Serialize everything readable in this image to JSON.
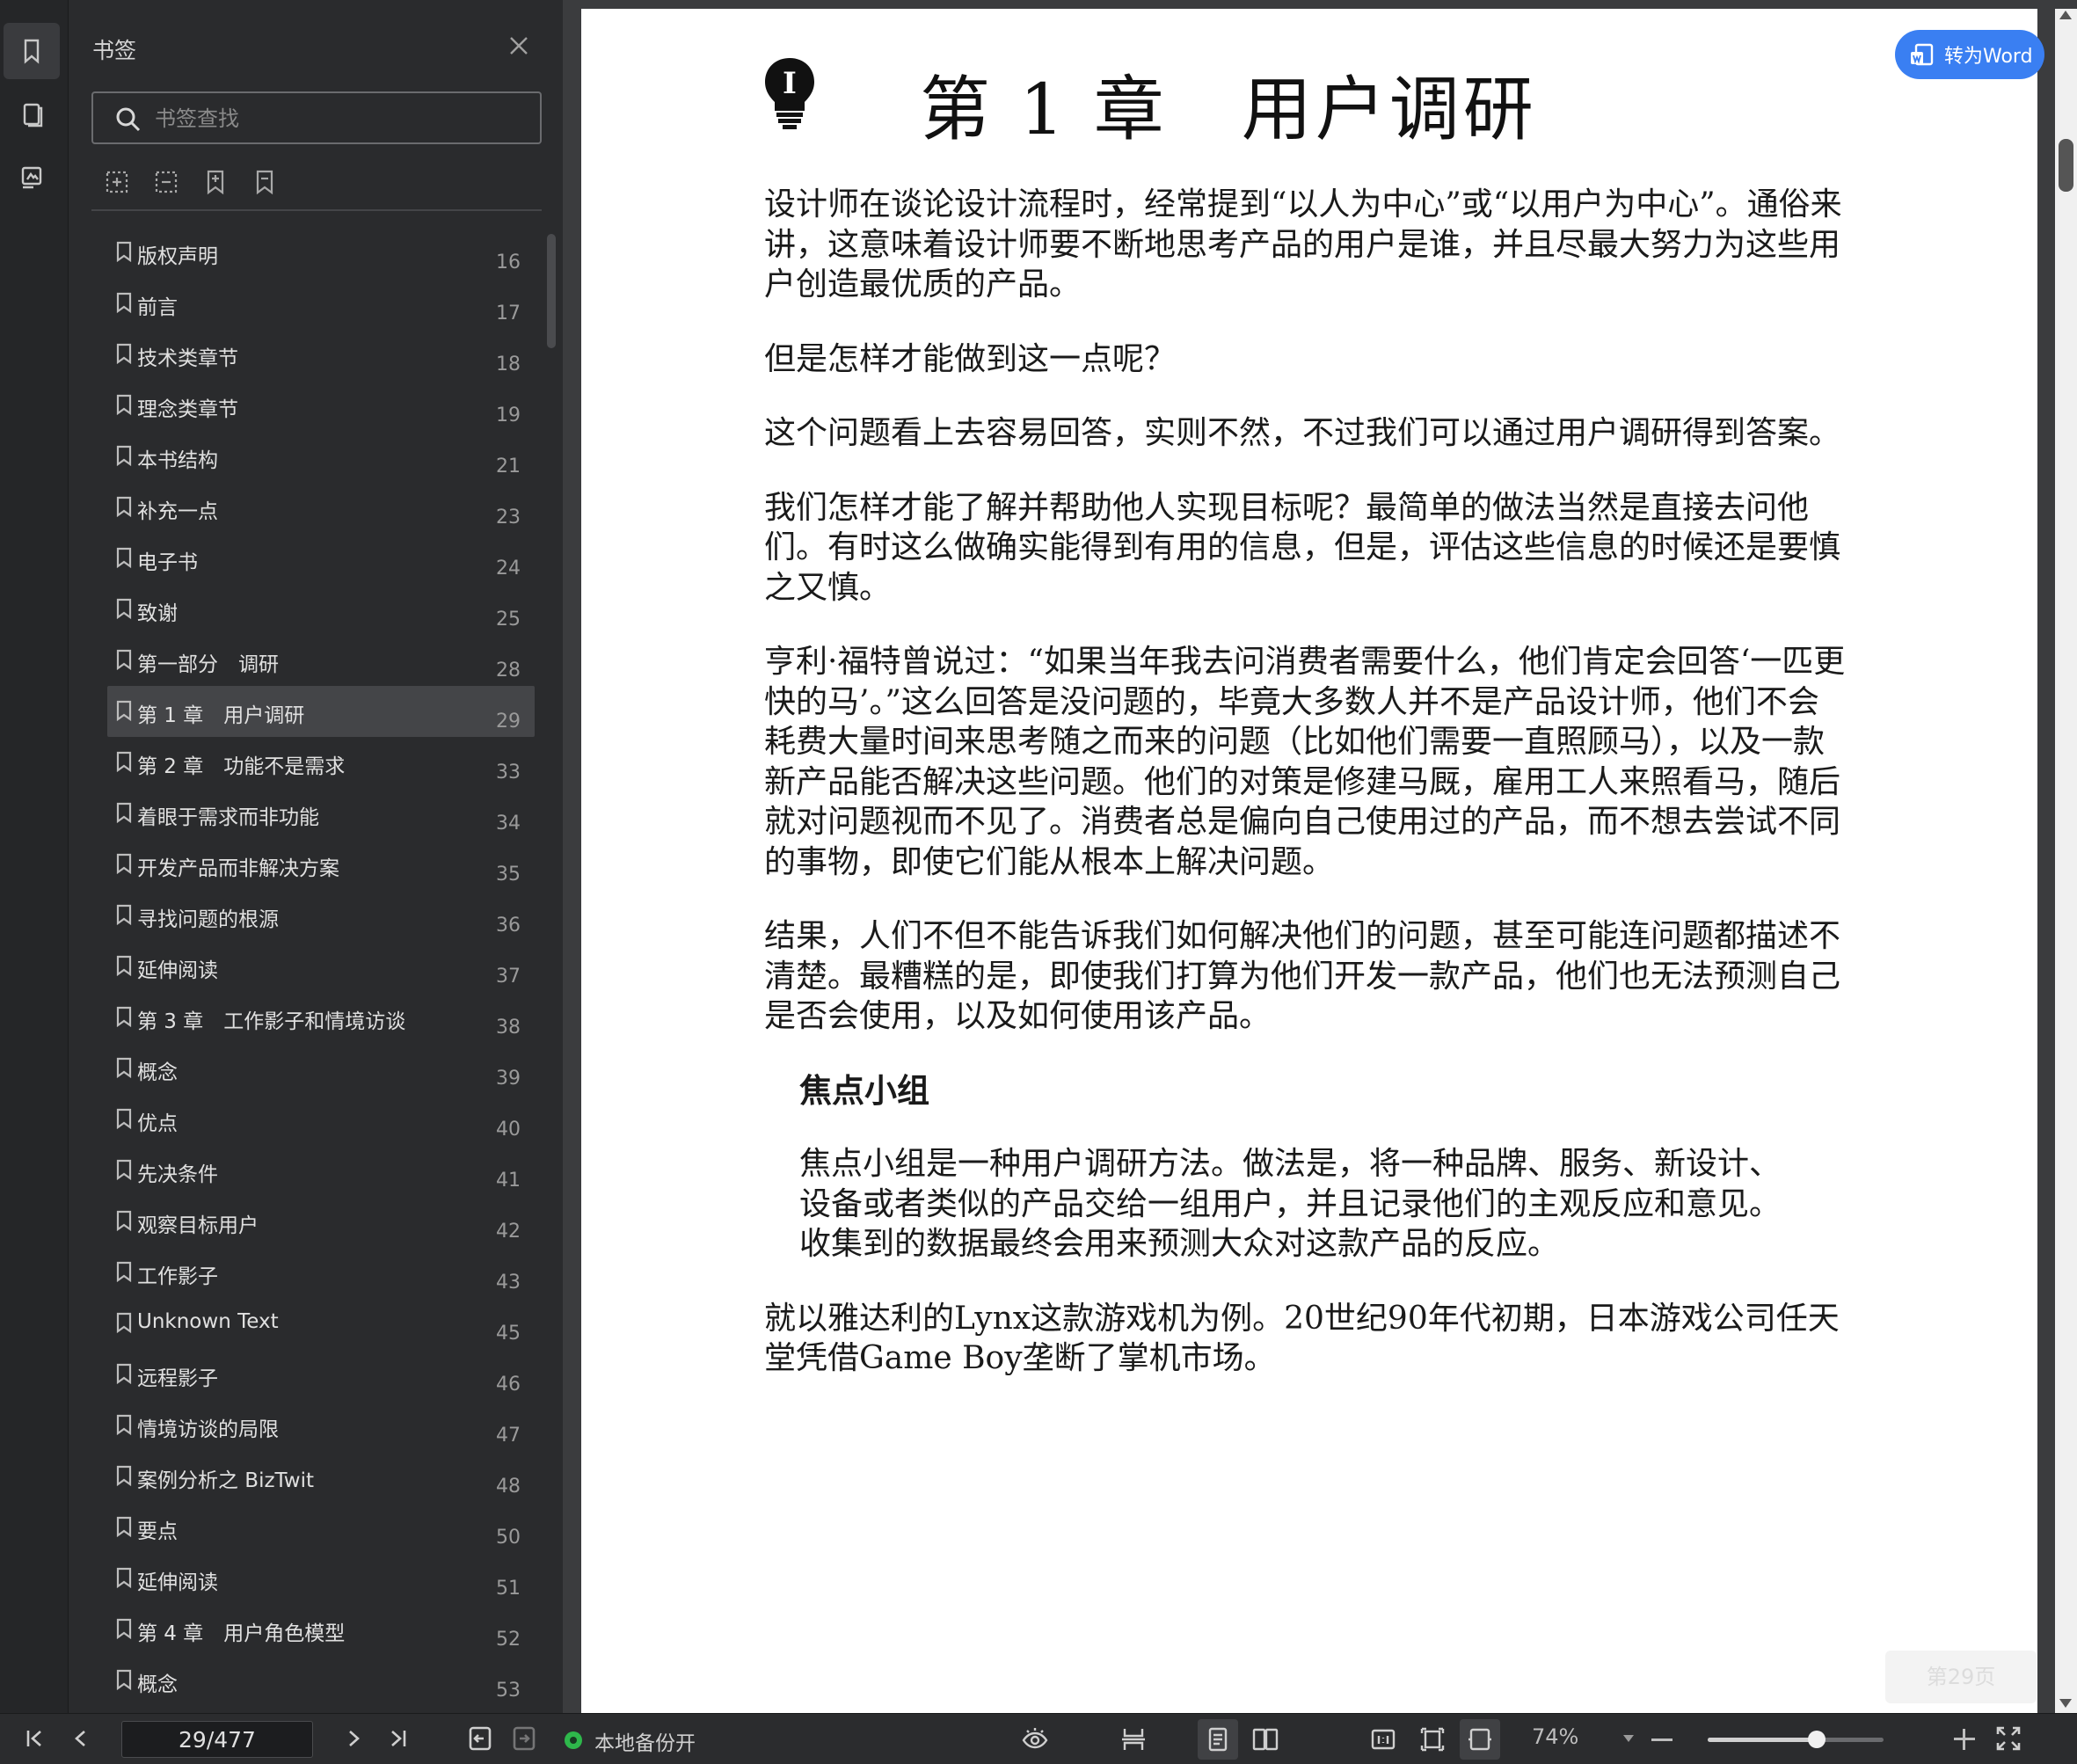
{
  "sidebar": {
    "title": "书签",
    "search_placeholder": "书签查找",
    "items": [
      {
        "label": "版权声明",
        "page": "16"
      },
      {
        "label": "前言",
        "page": "17"
      },
      {
        "label": "技术类章节",
        "page": "18"
      },
      {
        "label": "理念类章节",
        "page": "19"
      },
      {
        "label": "本书结构",
        "page": "21"
      },
      {
        "label": "补充一点",
        "page": "23"
      },
      {
        "label": "电子书",
        "page": "24"
      },
      {
        "label": "致谢",
        "page": "25"
      },
      {
        "label": "第一部分　调研",
        "page": "28"
      },
      {
        "label": "第 1 章　用户调研",
        "page": "29",
        "active": true
      },
      {
        "label": "第 2 章　功能不是需求",
        "page": "33"
      },
      {
        "label": "着眼于需求而非功能",
        "page": "34"
      },
      {
        "label": "开发产品而非解决方案",
        "page": "35"
      },
      {
        "label": "寻找问题的根源",
        "page": "36"
      },
      {
        "label": "延伸阅读",
        "page": "37"
      },
      {
        "label": "第 3 章　工作影子和情境访谈",
        "page": "38"
      },
      {
        "label": "概念",
        "page": "39"
      },
      {
        "label": "优点",
        "page": "40"
      },
      {
        "label": "先决条件",
        "page": "41"
      },
      {
        "label": "观察目标用户",
        "page": "42"
      },
      {
        "label": "工作影子",
        "page": "43"
      },
      {
        "label": "Unknown Text",
        "page": "45"
      },
      {
        "label": "远程影子",
        "page": "46"
      },
      {
        "label": "情境访谈的局限",
        "page": "47"
      },
      {
        "label": "案例分析之 BizTwit",
        "page": "48"
      },
      {
        "label": "要点",
        "page": "50"
      },
      {
        "label": "延伸阅读",
        "page": "51"
      },
      {
        "label": "第 4 章　用户角色模型",
        "page": "52"
      },
      {
        "label": "概念",
        "page": "53"
      }
    ]
  },
  "document": {
    "chapter_title": "第 1 章　用户调研",
    "paragraphs": [
      "设计师在谈论设计流程时，经常提到“以人为中心”或“以用户为中心”。通俗来讲，这意味着设计师要不断地思考产品的用户是谁，并且尽最大努力为这些用户创造最优质的产品。",
      "但是怎样才能做到这一点呢？",
      "这个问题看上去容易回答，实则不然，不过我们可以通过用户调研得到答案。",
      "我们怎样才能了解并帮助他人实现目标呢？最简单的做法当然是直接去问他们。有时这么做确实能得到有用的信息，但是，评估这些信息的时候还是要慎之又慎。",
      "亨利·福特曾说过：“如果当年我去问消费者需要什么，他们肯定会回答‘一匹更快的马’。”这么回答是没问题的，毕竟大多数人并不是产品设计师，他们不会耗费大量时间来思考随之而来的问题（比如他们需要一直照顾马），以及一款新产品能否解决这些问题。他们的对策是修建马厩，雇用工人来照看马，随后就对问题视而不见了。消费者总是偏向自己使用过的产品，而不想去尝试不同的事物，即使它们能从根本上解决问题。",
      "结果，人们不但不能告诉我们如何解决他们的问题，甚至可能连问题都描述不清楚。最糟糕的是，即使我们打算为他们开发一款产品，他们也无法预测自己是否会使用，以及如何使用该产品。"
    ],
    "sidebar_heading": "焦点小组",
    "sidebar_text": "焦点小组是一种用户调研方法。做法是，将一种品牌、服务、新设计、设备或者类似的产品交给一组用户，并且记录他们的主观反应和意见。收集到的数据最终会用来预测大众对这款产品的反应。",
    "last_paragraph": "就以雅达利的Lynx这款游戏机为例。20世纪90年代初期，日本游戏公司任天堂凭借Game Boy垄断了掌机市场。",
    "page_badge": "第29页"
  },
  "toolbar": {
    "convert_word_label": "转为Word",
    "page_indicator": "29/477",
    "backup_label": "本地备份开",
    "zoom_label": "74%",
    "zoom_fraction": 0.62
  },
  "colors": {
    "accent": "#3a7ff2",
    "backup_status": "#2eb84b"
  }
}
